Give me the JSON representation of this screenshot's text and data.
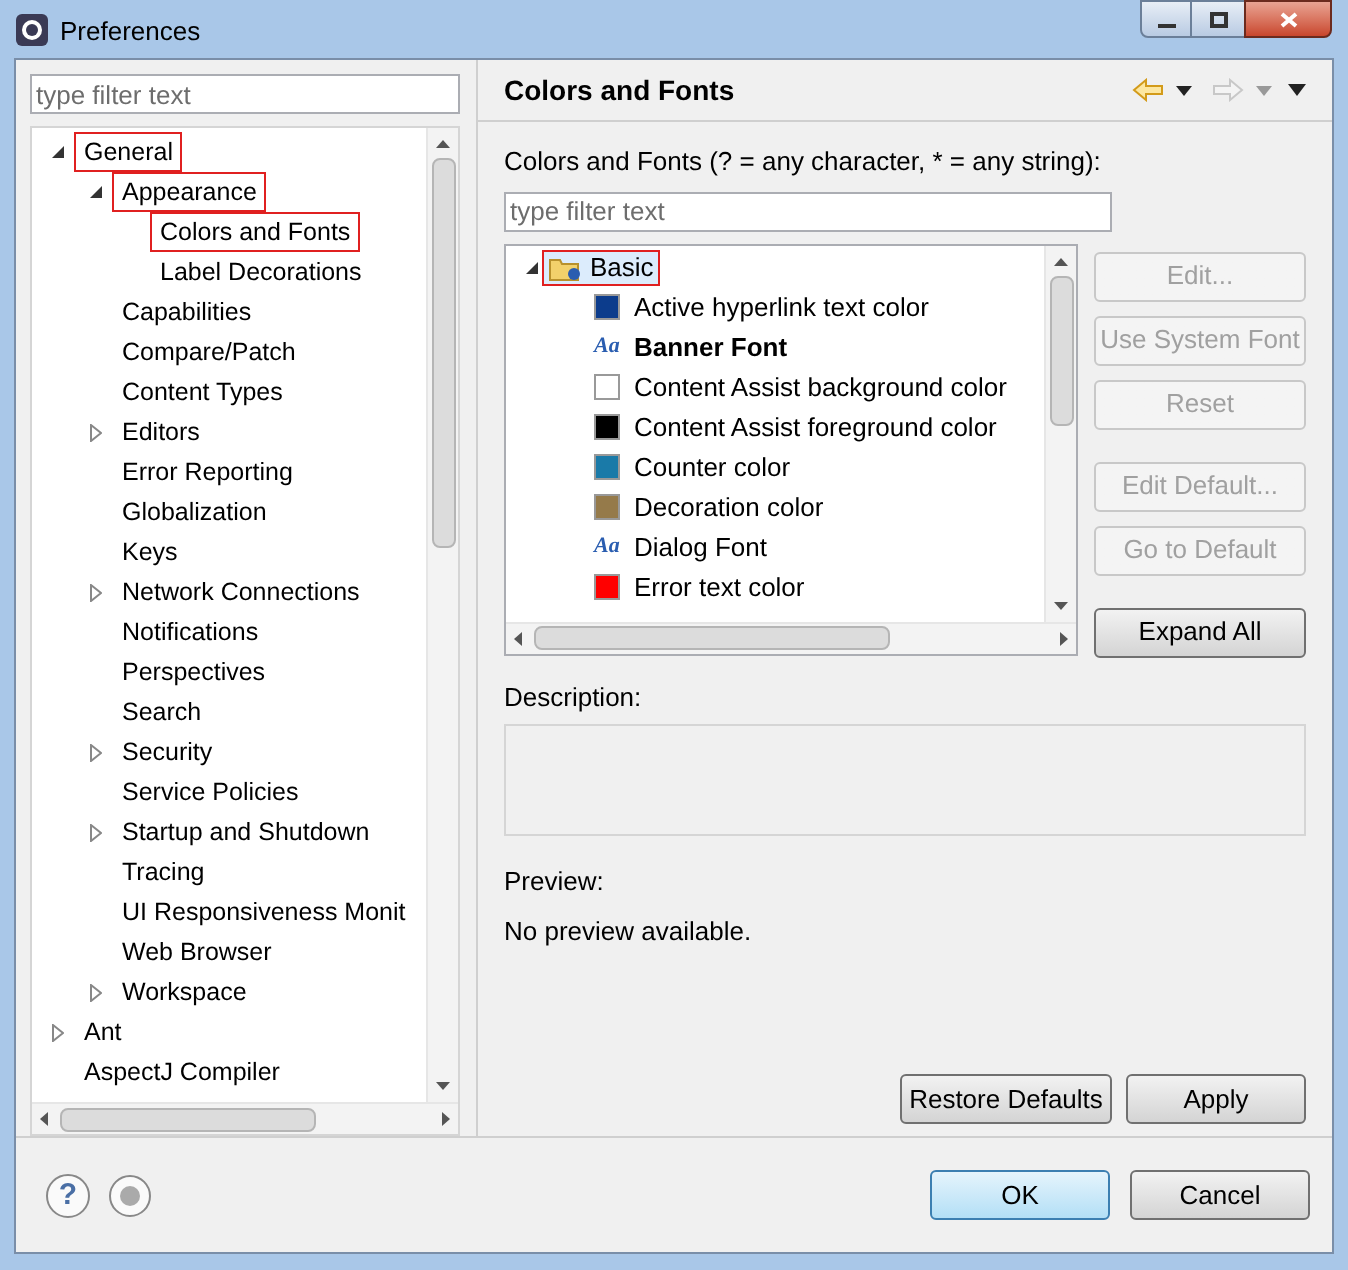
{
  "window": {
    "title": "Preferences"
  },
  "sidebar": {
    "filter": {
      "placeholder": "type filter text"
    },
    "tree": [
      {
        "label": "General",
        "expanded": true,
        "marked": true,
        "children": [
          {
            "label": "Appearance",
            "expanded": true,
            "marked": true,
            "children": [
              {
                "label": "Colors and Fonts",
                "marked": true
              },
              {
                "label": "Label Decorations",
                "marked": false
              }
            ]
          },
          {
            "label": "Capabilities",
            "marked": false
          },
          {
            "label": "Compare/Patch",
            "marked": false
          },
          {
            "label": "Content Types",
            "marked": false
          },
          {
            "label": "Editors",
            "expanded": false,
            "marked": false
          },
          {
            "label": "Error Reporting",
            "marked": false
          },
          {
            "label": "Globalization",
            "marked": false
          },
          {
            "label": "Keys",
            "marked": false
          },
          {
            "label": "Network Connections",
            "expanded": false,
            "marked": false
          },
          {
            "label": "Notifications",
            "marked": false
          },
          {
            "label": "Perspectives",
            "marked": false
          },
          {
            "label": "Search",
            "marked": false
          },
          {
            "label": "Security",
            "expanded": false,
            "marked": false
          },
          {
            "label": "Service Policies",
            "marked": false
          },
          {
            "label": "Startup and Shutdown",
            "expanded": false,
            "marked": false
          },
          {
            "label": "Tracing",
            "marked": false
          },
          {
            "label": "UI Responsiveness Monit",
            "marked": false
          },
          {
            "label": "Web Browser",
            "marked": false
          },
          {
            "label": "Workspace",
            "expanded": false,
            "marked": false
          }
        ]
      },
      {
        "label": "Ant",
        "expanded": false,
        "marked": false
      },
      {
        "label": "AspectJ Compiler",
        "marked": false
      }
    ]
  },
  "page": {
    "title": "Colors and Fonts",
    "filter_label": "Colors and Fonts (? = any character, * = any string):",
    "filter": {
      "placeholder": "type filter text"
    },
    "tree": {
      "label": "Basic",
      "expanded": true,
      "marked": true,
      "children": [
        {
          "kind": "color",
          "label": "Active hyperlink text color",
          "color": "#0c3c8c"
        },
        {
          "kind": "font",
          "icon": "Aa",
          "label": "Banner Font",
          "bold": true
        },
        {
          "kind": "color",
          "label": "Content Assist background color",
          "color": "#ffffff"
        },
        {
          "kind": "color",
          "label": "Content Assist foreground color",
          "color": "#000000"
        },
        {
          "kind": "color",
          "label": "Counter color",
          "color": "#1a7aa8"
        },
        {
          "kind": "color",
          "label": "Decoration color",
          "color": "#957a4a"
        },
        {
          "kind": "font",
          "icon": "Aa",
          "label": "Dialog Font",
          "bold": false
        },
        {
          "kind": "color",
          "label": "Error text color",
          "color": "#ff0000"
        }
      ]
    },
    "side_buttons": [
      {
        "label": "Edit...",
        "disabled": true
      },
      {
        "label": "Use System Font",
        "disabled": true
      },
      {
        "label": "Reset",
        "disabled": true
      },
      {
        "label": "Edit Default...",
        "disabled": true
      },
      {
        "label": "Go to Default",
        "disabled": true
      },
      {
        "label": "Expand All",
        "disabled": false
      }
    ],
    "description_label": "Description:",
    "preview_label": "Preview:",
    "preview_text": "No preview available.",
    "page_buttons": [
      "Restore Defaults",
      "Apply"
    ]
  },
  "help": {
    "icon": "?"
  },
  "dialog_buttons": [
    {
      "label": "OK",
      "default": true
    },
    {
      "label": "Cancel",
      "default": false
    }
  ]
}
